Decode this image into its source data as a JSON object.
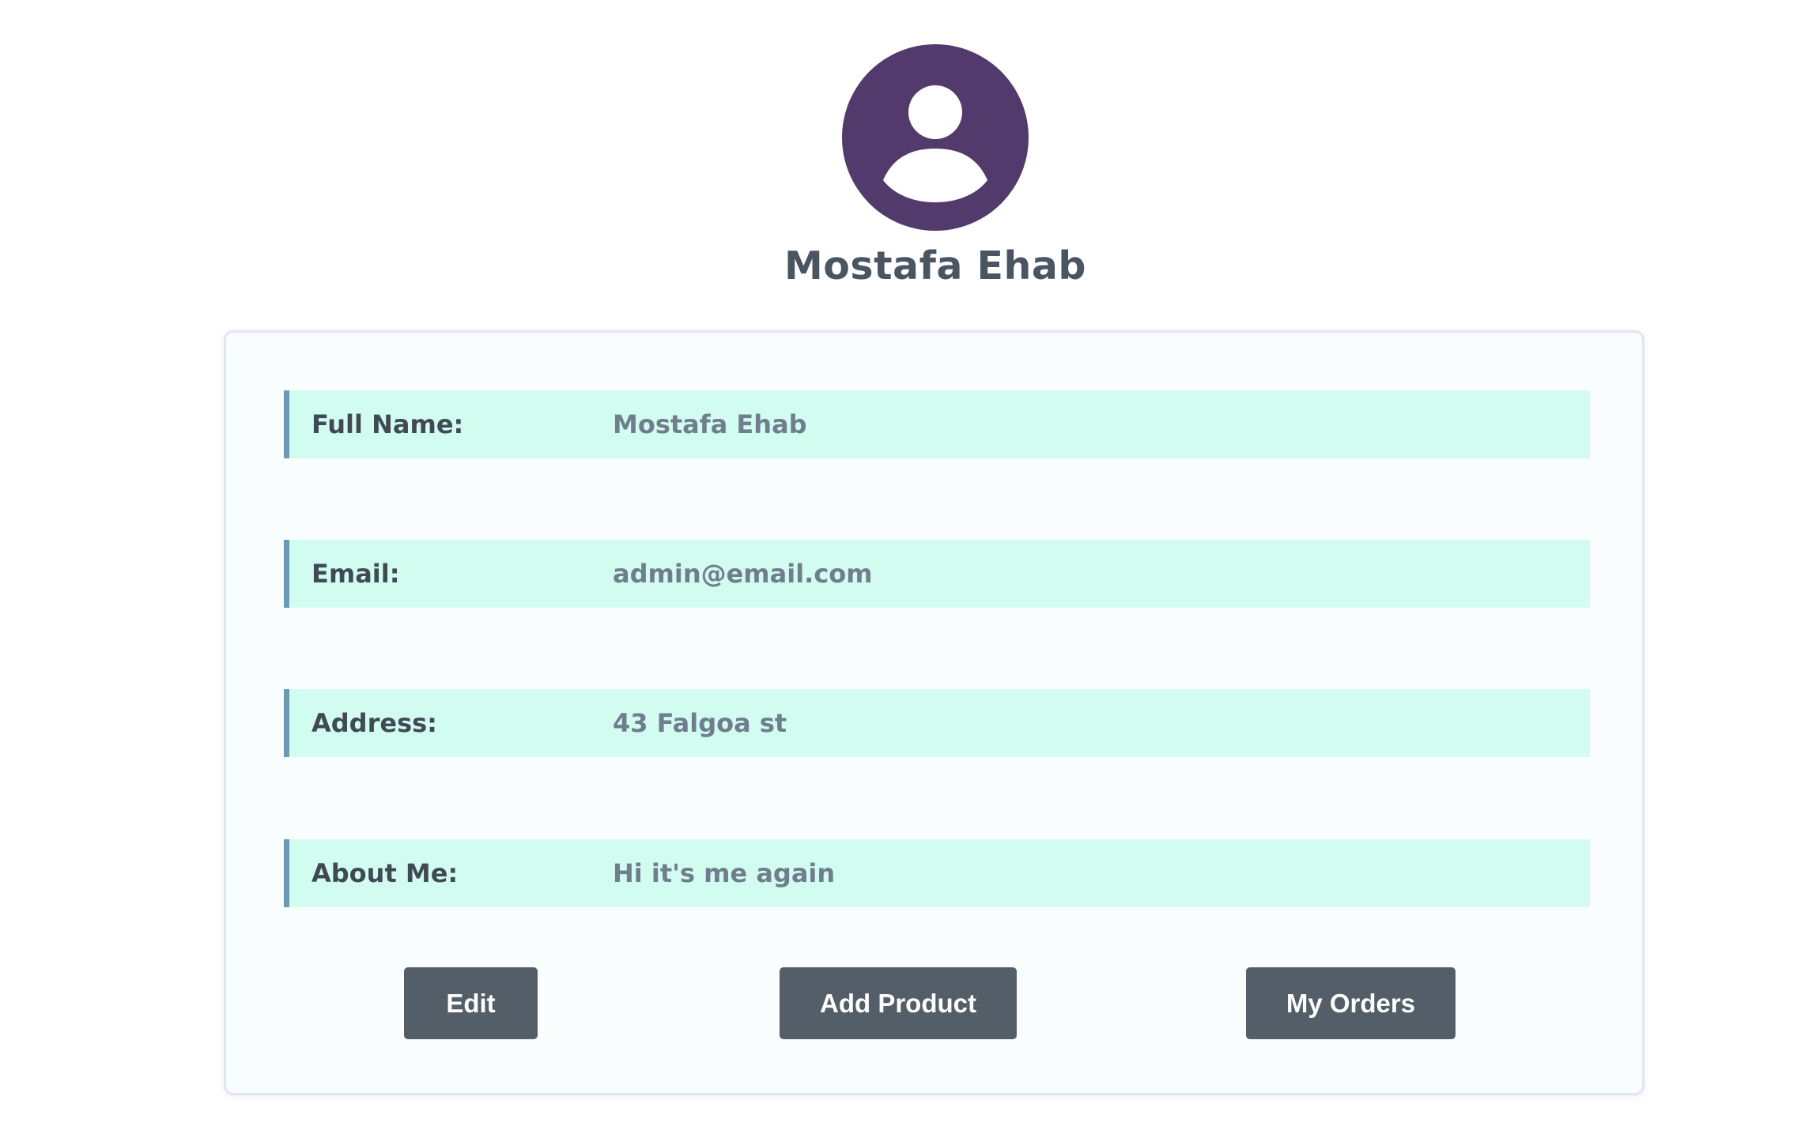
{
  "profile": {
    "name": "Mostafa Ehab",
    "avatar_color": "#533a6c",
    "avatar_icon": "user-silhouette-icon"
  },
  "details": [
    {
      "label": "Full Name:",
      "value": "Mostafa Ehab"
    },
    {
      "label": "Email:",
      "value": "admin@email.com"
    },
    {
      "label": "Address:",
      "value": "43 Falgoa st"
    },
    {
      "label": "About Me:",
      "value": "Hi it's me again"
    }
  ],
  "actions": {
    "edit_label": "Edit",
    "add_product_label": "Add Product",
    "my_orders_label": "My Orders"
  },
  "colors": {
    "row_background": "#d3fcf0",
    "row_accent": "#6a9bb5",
    "button_background": "#545e69",
    "card_background": "#f9fdfd"
  }
}
